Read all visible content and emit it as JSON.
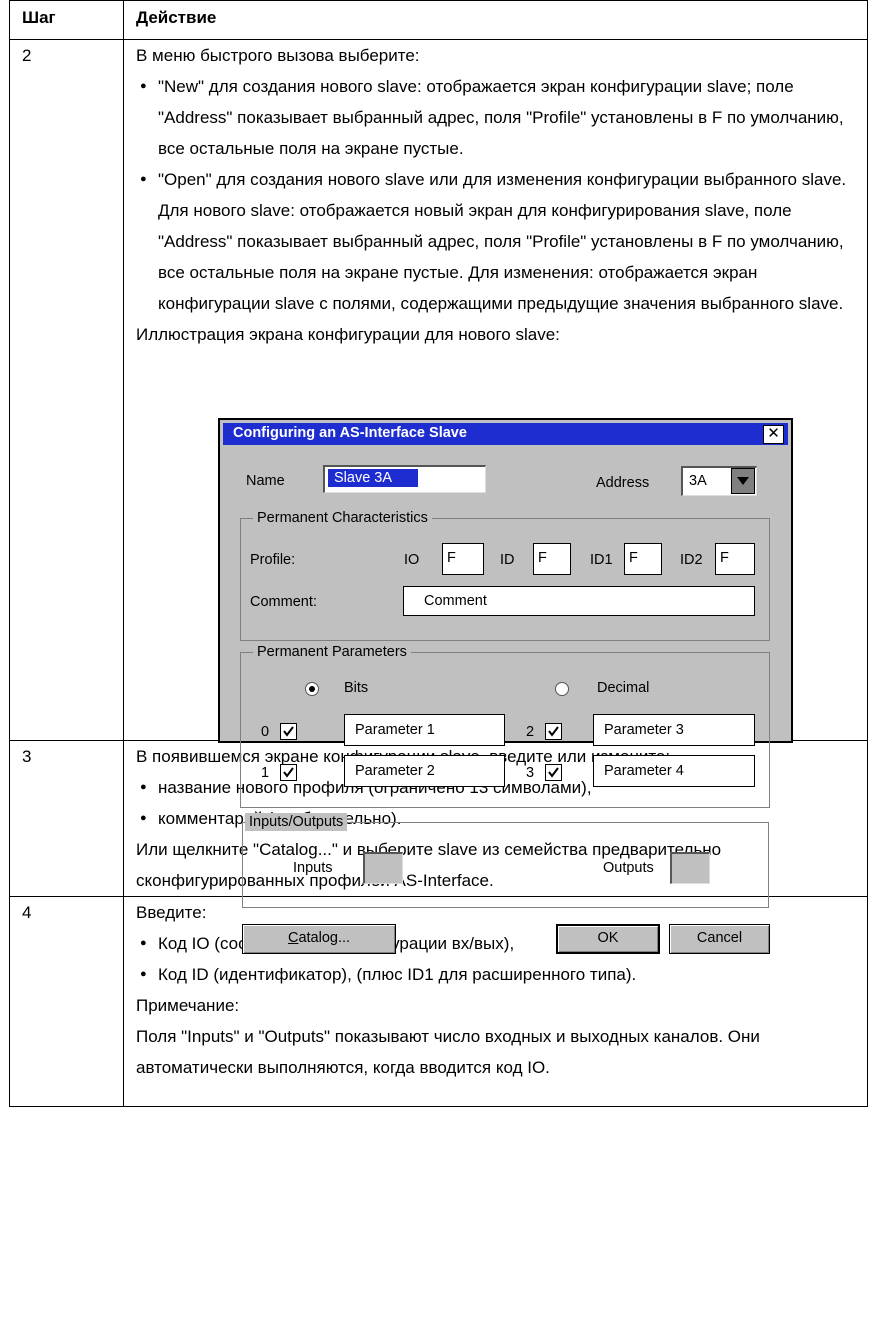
{
  "table": {
    "header": {
      "step": "Шаг",
      "action": "Действие"
    },
    "rows": [
      {
        "step": "2",
        "intro": "В меню быстрого вызова выберите:",
        "bullets": [
          "\"New\" для создания нового slave: отображается экран конфигурации slave; поле \"Address\" показывает выбранный адрес, поля \"Profile\" установлены в F по умолчанию, все остальные поля на экране пустые.",
          "\"Open\" для создания нового slave или для изменения конфигурации выбранного slave. Для нового slave: отображается новый экран для конфигурирования slave, поле \"Address\" показывает выбранный адрес, поля \"Profile\" установлены в F по умолчанию, все остальные поля на экране пустые. Для изменения: отображается экран конфигурации slave с полями, содержащими предыдущие значения выбранного slave."
        ],
        "outro": "Иллюстрация экрана конфигурации для нового slave:"
      },
      {
        "step": "3",
        "intro": "В появившемся экране конфигурации slave, введите или измените:",
        "bullets": [
          "название нового профиля (ограничено 13 символами),",
          "комментарий (необязательно)."
        ],
        "outro": "Или щелкните \"Catalog...\" и выберите slave из семейства предварительно сконфигурированных профилей AS-Interface."
      },
      {
        "step": "4",
        "intro": "Введите:",
        "bullets": [
          "Код IO (соответствует конфигурации вх/вых),",
          "Код ID (идентификатор), (плюс ID1 для расширенного типа)."
        ],
        "note_label": "Примечание:",
        "outro": "Поля \"Inputs\" и \"Outputs\" показывают число входных и выходных каналов. Они автоматически выполняются, когда вводится код IO."
      }
    ]
  },
  "dialog": {
    "title": "Configuring an AS-Interface Slave",
    "close": "✕",
    "name_label": "Name",
    "name_value": "Slave 3A",
    "address_label": "Address",
    "address_value": "3A",
    "perm_char": {
      "legend": "Permanent Characteristics",
      "profile_label": "Profile:",
      "io_label": "IO",
      "io_value": "F",
      "id_label": "ID",
      "id_value": "F",
      "id1_label": "ID1",
      "id1_value": "F",
      "id2_label": "ID2",
      "id2_value": "F",
      "comment_label": "Comment:",
      "comment_value": "Comment"
    },
    "perm_params": {
      "legend": "Permanent Parameters",
      "radio_bits": "Bits",
      "radio_decimal": "Decimal",
      "selected": "Bits",
      "params": [
        {
          "index": "0",
          "label": "Parameter 1",
          "checked": true
        },
        {
          "index": "1",
          "label": "Parameter 2",
          "checked": true
        },
        {
          "index": "2",
          "label": "Parameter 3",
          "checked": true
        },
        {
          "index": "3",
          "label": "Parameter 4",
          "checked": true
        }
      ]
    },
    "io": {
      "legend": "Inputs/Outputs",
      "inputs_label": "Inputs",
      "outputs_label": "Outputs"
    },
    "buttons": {
      "catalog_rest": "atalog...",
      "catalog_mnemonic": "C",
      "ok": "OK",
      "cancel": "Cancel"
    }
  }
}
